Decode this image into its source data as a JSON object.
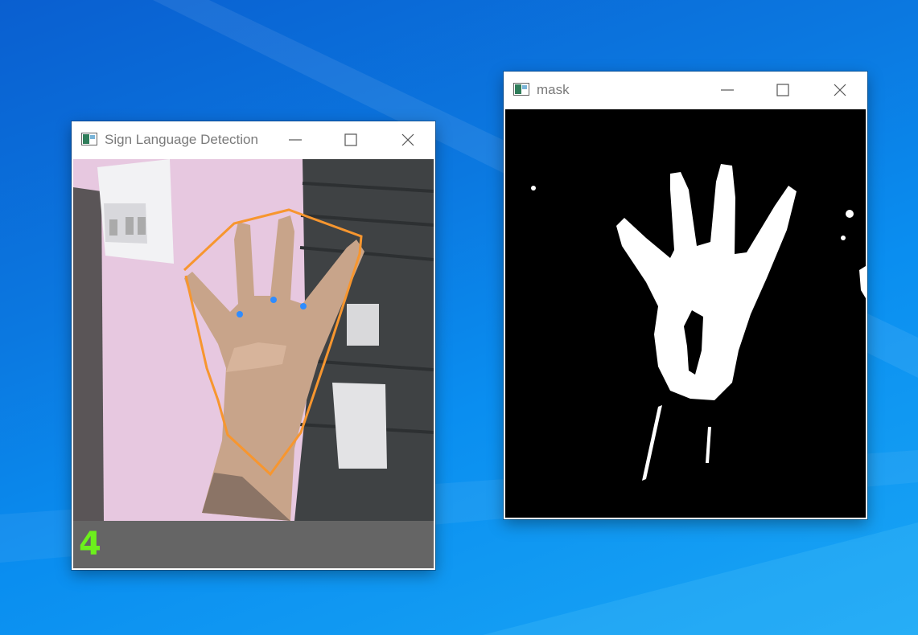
{
  "windows": {
    "detection": {
      "title": "Sign Language Detection",
      "finger_count": "4",
      "buttons": [
        "minimize",
        "maximize",
        "close"
      ]
    },
    "mask": {
      "title": "mask",
      "buttons": [
        "minimize",
        "maximize",
        "close"
      ]
    }
  },
  "icons": {
    "app": "opencv-window-icon",
    "minimize": "minimize-icon",
    "maximize": "maximize-icon",
    "close": "close-icon"
  },
  "colors": {
    "contour": "#f7962f",
    "defect_points": "#2f8cff",
    "count_text": "#6cf01c",
    "status_bar": "#656565"
  }
}
